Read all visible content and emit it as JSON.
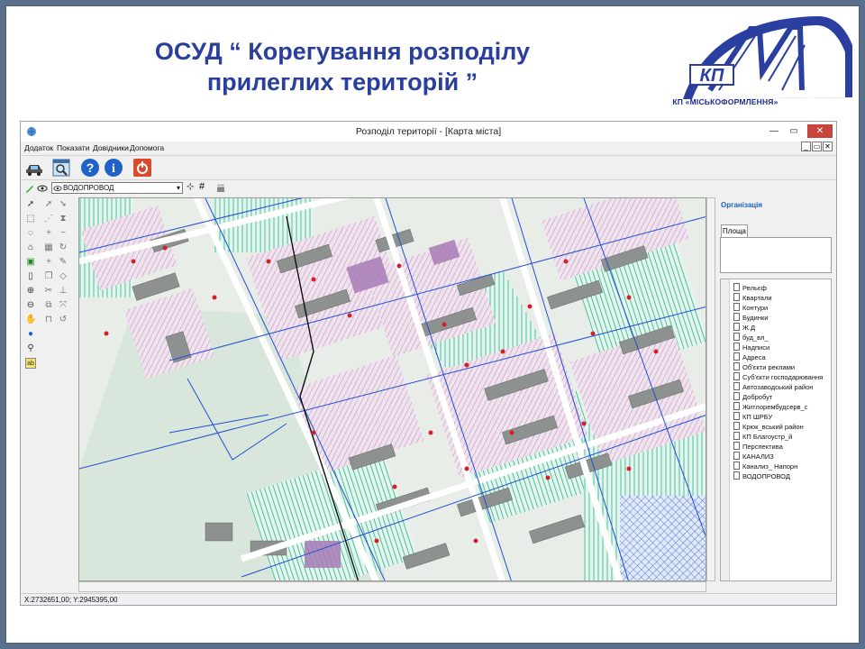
{
  "slide": {
    "title_line1": "ОСУД “ Корегування розподілу",
    "title_line2": "прилеглих територій ”",
    "logo_text": "КП",
    "logo_caption": "КП «МІСЬКОФОРМЛЕННЯ»"
  },
  "window": {
    "title": "Розподіл території - [Карта міста]",
    "minimize": "—",
    "maximize": "▭",
    "close": "✕"
  },
  "menu": [
    "Додаток",
    "Показати",
    "Довідники",
    "Допомога"
  ],
  "mdi_buttons": [
    "_",
    "▭",
    "✕"
  ],
  "layer_selector": {
    "value": "ВОДОПРОВОД"
  },
  "right_panel": {
    "title": "Організація",
    "tab": "Площа",
    "layers": [
      "Рельєф",
      "Квартали",
      "Контури",
      "Будинки",
      "Ж.Д",
      "буд_вл_",
      "Надписи",
      "Адреса",
      "Об'єкти реклами",
      "Суб'єкти господарювання",
      "Автозаводський район",
      "Добробут",
      "Житлорембудсерв_с",
      "КП ШРБУ",
      "Крюк_вський район",
      "КП Благоустр_й",
      "Перспектива",
      "КАНАЛИЗ",
      "Канализ_ Напорн",
      "ВОДОПРОВОД"
    ]
  },
  "status": {
    "coords": "X:2732651,00; Y:2945395,00"
  },
  "colors": {
    "title_blue": "#2a3f9c",
    "map_green": "#3cbf8f",
    "map_pink": "#b07aa8",
    "map_blue_pipe": "#1f4fd6",
    "building_gray": "#8d9190",
    "marker_red": "#d3202a"
  },
  "icons": {
    "toolbar": [
      "car-icon",
      "search-window-icon",
      "help-icon",
      "info-icon",
      "power-icon"
    ],
    "layerbar": [
      "pencil-icon",
      "eye-icon",
      "eye-icon",
      "grid-icon",
      "print-icon"
    ]
  }
}
